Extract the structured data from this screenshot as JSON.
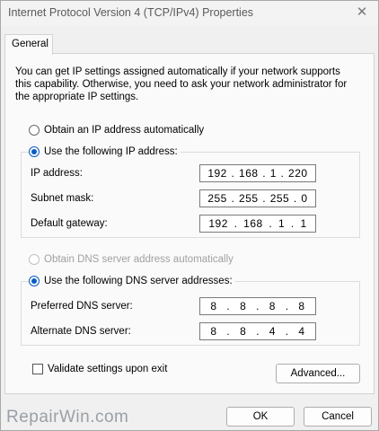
{
  "window": {
    "title": "Internet Protocol Version 4 (TCP/IPv4) Properties",
    "close_glyph": "✕"
  },
  "tabs": [
    {
      "label": "General"
    }
  ],
  "intro_text": "You can get IP settings assigned automatically if your network supports this capability. Otherwise, you need to ask your network administrator for the appropriate IP settings.",
  "ip_section": {
    "auto_label": "Obtain an IP address automatically",
    "manual_label": "Use the following IP address:",
    "selected": "manual",
    "fields": [
      {
        "label": "IP address:",
        "octets": [
          "192",
          "168",
          "1",
          "220"
        ]
      },
      {
        "label": "Subnet mask:",
        "octets": [
          "255",
          "255",
          "255",
          "0"
        ]
      },
      {
        "label": "Default gateway:",
        "octets": [
          "192",
          "168",
          "1",
          "1"
        ]
      }
    ]
  },
  "dns_section": {
    "auto_label": "Obtain DNS server address automatically",
    "manual_label": "Use the following DNS server addresses:",
    "selected": "manual",
    "fields": [
      {
        "label": "Preferred DNS server:",
        "octets": [
          "8",
          "8",
          "8",
          "8"
        ]
      },
      {
        "label": "Alternate DNS server:",
        "octets": [
          "8",
          "8",
          "4",
          "4"
        ]
      }
    ]
  },
  "validate": {
    "label": "Validate settings upon exit",
    "checked": false
  },
  "buttons": {
    "advanced": "Advanced...",
    "ok": "OK",
    "cancel": "Cancel"
  },
  "watermark": "RepairWin.com",
  "colors": {
    "accent": "#0a5bc4",
    "disabled_text": "#a0a0a0"
  }
}
